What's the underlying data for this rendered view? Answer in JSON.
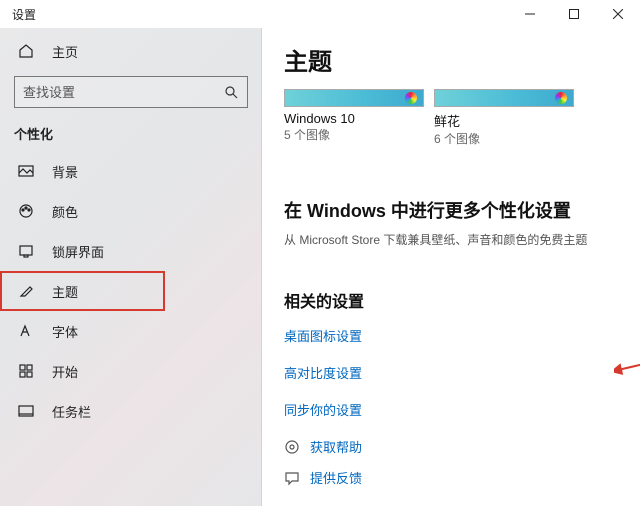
{
  "titlebar": {
    "title": "设置"
  },
  "sidebar": {
    "home": "主页",
    "search_placeholder": "查找设置",
    "category": "个性化",
    "items": [
      {
        "label": "背景"
      },
      {
        "label": "颜色"
      },
      {
        "label": "锁屏界面"
      },
      {
        "label": "主题"
      },
      {
        "label": "字体"
      },
      {
        "label": "开始"
      },
      {
        "label": "任务栏"
      }
    ]
  },
  "content": {
    "title": "主题",
    "themes": [
      {
        "name": "Windows 10",
        "sub": "5 个图像"
      },
      {
        "name": "鲜花",
        "sub": "6 个图像"
      }
    ],
    "more_h": "在 Windows 中进行更多个性化设置",
    "more_sub": "从 Microsoft Store 下载兼具壁纸、声音和颜色的免费主题",
    "related_h": "相关的设置",
    "links": [
      "桌面图标设置",
      "高对比度设置",
      "同步你的设置"
    ],
    "help": "获取帮助",
    "feedback": "提供反馈"
  }
}
